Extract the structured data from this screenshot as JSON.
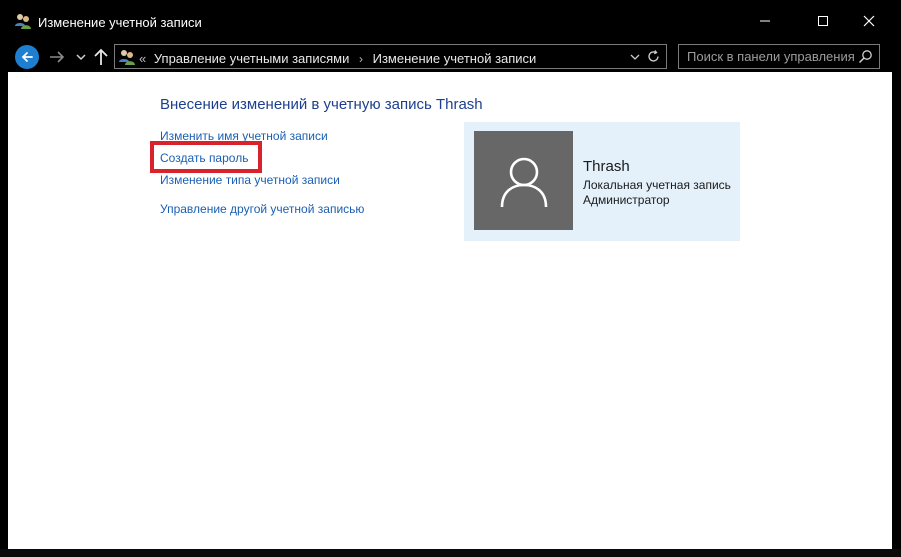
{
  "window": {
    "title": "Изменение учетной записи",
    "icon": "users-icon"
  },
  "nav": {
    "back_icon": "arrow-left-icon",
    "forward_icon": "arrow-right-icon",
    "recent_icon": "chevron-down-icon",
    "up_icon": "arrow-up-icon"
  },
  "address": {
    "overflow": "«",
    "crumbs": [
      "Управление учетными записями",
      "Изменение учетной записи"
    ],
    "separator": "›"
  },
  "search": {
    "placeholder": "Поиск в панели управления"
  },
  "main": {
    "heading": "Внесение изменений в учетную запись Thrash",
    "links": {
      "rename": "Изменить имя учетной записи",
      "password": "Создать пароль",
      "type": "Изменение типа учетной записи",
      "other": "Управление другой учетной записью"
    }
  },
  "account": {
    "name": "Thrash",
    "type": "Локальная учетная запись",
    "role": "Администратор"
  },
  "colors": {
    "accent": "#1e7fd1",
    "link": "#1a5fb4",
    "heading": "#1e3f8f",
    "highlight": "#d9222b",
    "card": "#e4f1fb"
  }
}
